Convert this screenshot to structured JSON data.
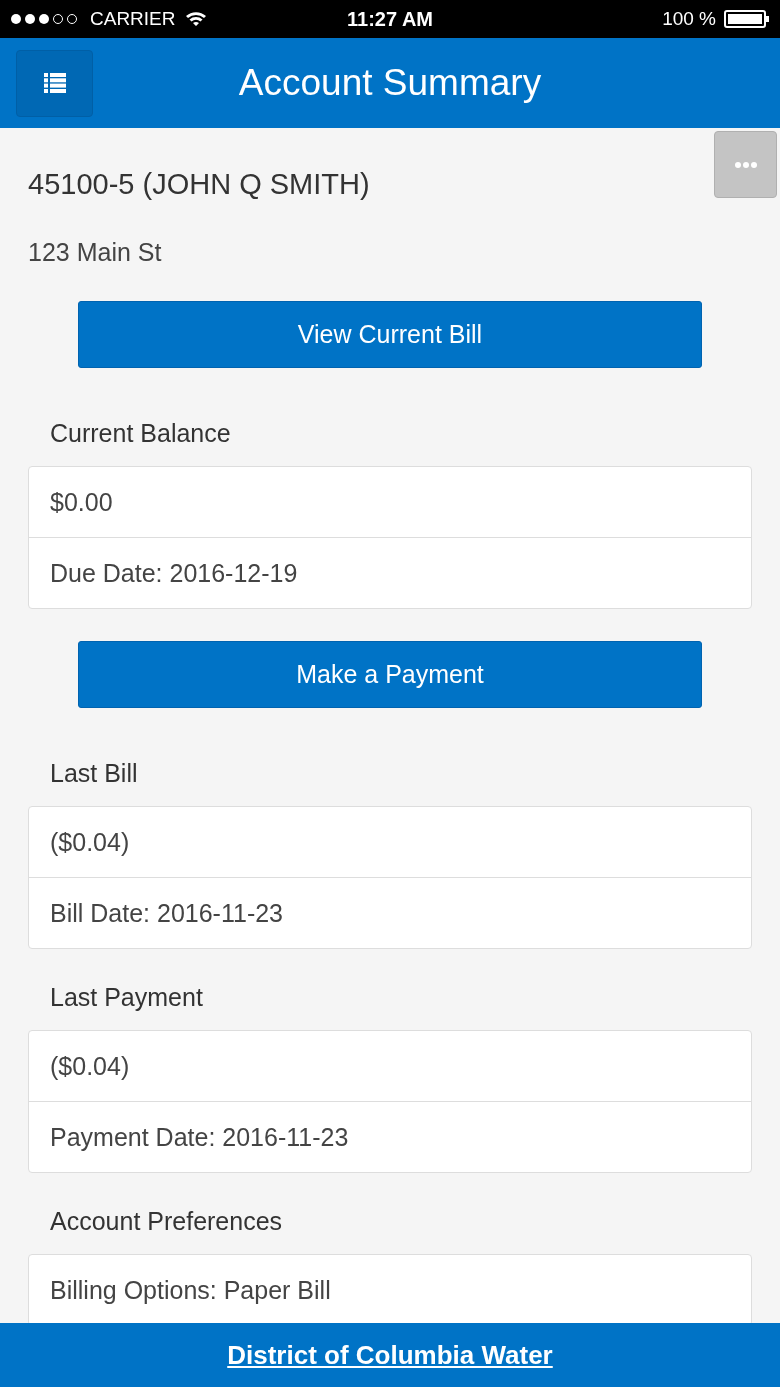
{
  "status_bar": {
    "carrier": "CARRIER",
    "time": "11:27 AM",
    "battery": "100 %"
  },
  "header": {
    "title": "Account Summary"
  },
  "account": {
    "title": "45100-5 (JOHN Q SMITH)",
    "address": "123 Main St"
  },
  "sections": [
    {
      "kind": "button",
      "label": "View Current Bill"
    },
    {
      "kind": "panel",
      "heading": "Current Balance",
      "rows": [
        "$0.00",
        "Due Date: 2016-12-19"
      ]
    },
    {
      "kind": "button",
      "label": "Make a Payment"
    },
    {
      "kind": "panel",
      "heading": "Last Bill",
      "rows": [
        "($0.04)",
        "Bill Date: 2016-11-23"
      ]
    },
    {
      "kind": "panel",
      "heading": "Last Payment",
      "rows": [
        "($0.04)",
        "Payment Date: 2016-11-23"
      ]
    },
    {
      "kind": "panel",
      "heading": "Account Preferences",
      "rows": [
        "Billing Options: Paper Bill"
      ]
    }
  ],
  "footer": {
    "link": "District of Columbia Water"
  }
}
